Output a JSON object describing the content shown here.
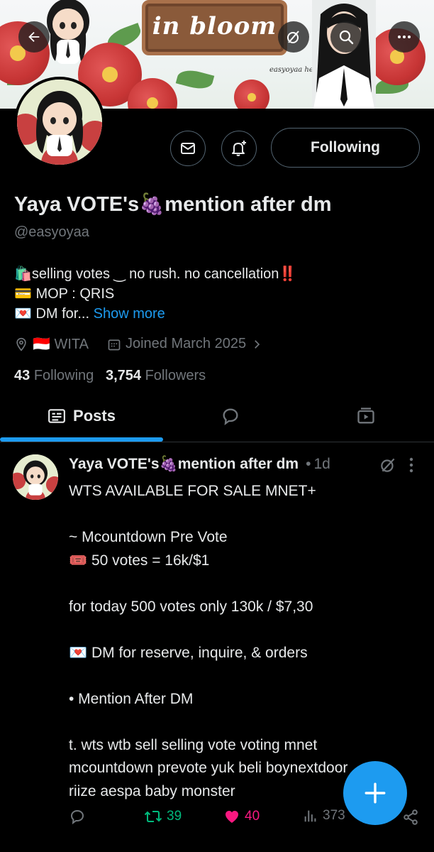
{
  "banner": {
    "sign_text": "in bloom",
    "caption": "easyoyaa here!"
  },
  "top_bar": {
    "back_icon": "arrow-left-icon",
    "mute_icon": "mute-icon",
    "search_icon": "search-icon",
    "more_icon": "more-icon"
  },
  "profile": {
    "name": "Yaya VOTE's",
    "name_emoji": "🍇",
    "name_suffix": "mention after dm",
    "handle": "@easyoyaa",
    "bio_line1": "selling votes ‿ no rush. no cancellation‼️",
    "bio_line1_emoji": "🛍️",
    "bio_line2": "MOP : QRIS",
    "bio_line2_emoji": "💳",
    "bio_line3": "DM for...",
    "bio_line3_emoji": "💌",
    "show_more": "Show more",
    "location": "🇮🇩 WITA",
    "joined": "Joined March 2025",
    "following_count": "43",
    "following_label": "Following",
    "followers_count": "3,754",
    "followers_label": "Followers",
    "following_button": "Following"
  },
  "tabs": {
    "posts": "Posts"
  },
  "post": {
    "author": "Yaya VOTE's",
    "author_emoji": "🍇",
    "author_suffix": "mention after dm",
    "time": "1d",
    "lines": [
      "WTS AVAILABLE FOR SALE MNET+",
      "",
      "~ Mcountdown Pre Vote",
      "🎟️ 50 votes = 16k/$1",
      "",
      "for today 500 votes only 130k / $7,30",
      "",
      "💌 DM for reserve, inquire, & orders",
      "",
      "• Mention After DM",
      "",
      "t. wts wtb sell selling vote voting mnet",
      "mcountdown prevote yuk beli boynextdoor",
      "riize aespa baby monster"
    ],
    "retweets": "39",
    "likes": "40",
    "views": "373"
  },
  "colors": {
    "accent": "#1d9bf0",
    "like": "#f91880",
    "retweet": "#00ba7c",
    "muted": "#71767b"
  }
}
